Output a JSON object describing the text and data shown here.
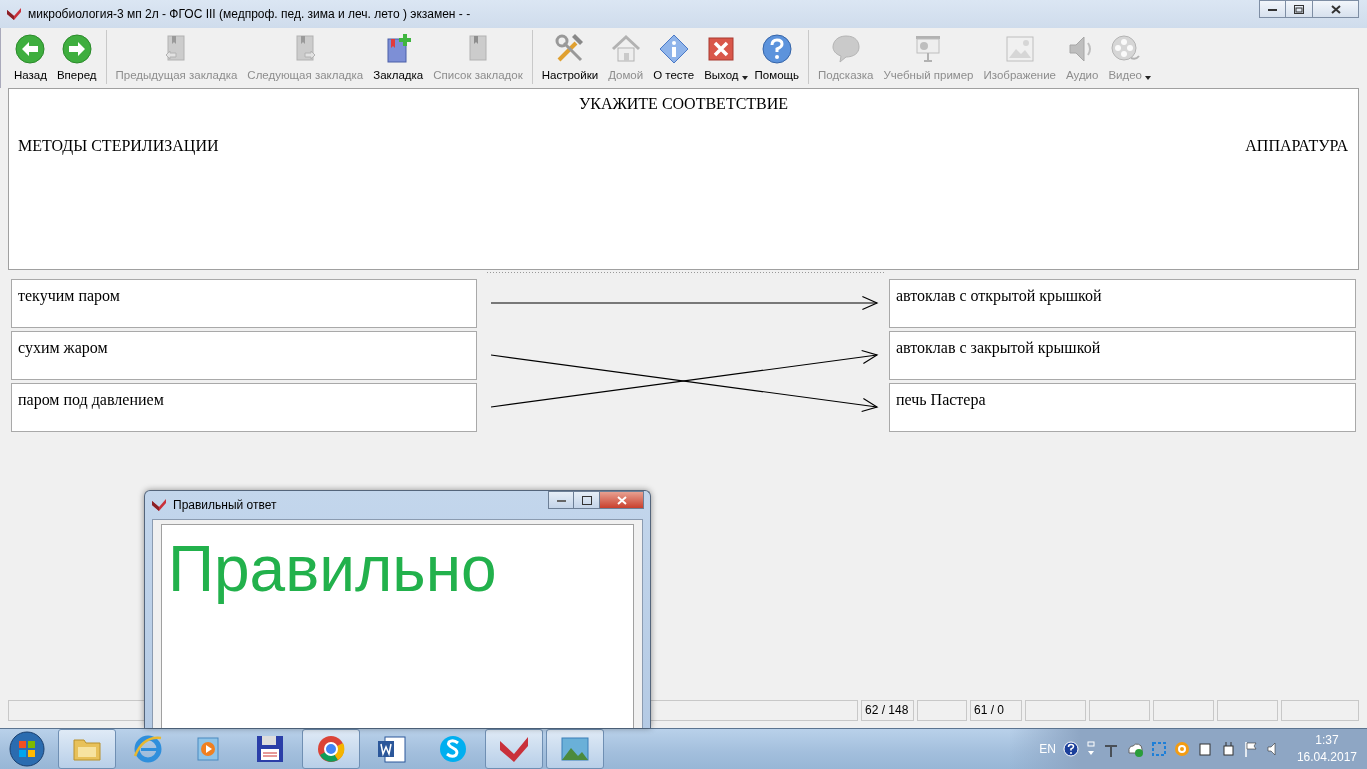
{
  "window": {
    "title": "микробиология-3 мп 2л - ФГОС III (медпроф. пед. зима и леч. лето ) экзамен -  -"
  },
  "toolbar": {
    "groups": [
      {
        "buttons": [
          {
            "label": "Назад",
            "disabled": false,
            "dropdown": false
          },
          {
            "label": "Вперед",
            "disabled": false,
            "dropdown": false
          }
        ]
      },
      {
        "buttons": [
          {
            "label": "Предыдущая закладка",
            "disabled": true,
            "dropdown": false
          },
          {
            "label": "Следующая закладка",
            "disabled": true,
            "dropdown": false
          },
          {
            "label": "Закладка",
            "disabled": false,
            "dropdown": false
          },
          {
            "label": "Список закладок",
            "disabled": true,
            "dropdown": false
          }
        ]
      },
      {
        "buttons": [
          {
            "label": "Настройки",
            "disabled": false,
            "dropdown": false
          },
          {
            "label": "Домой",
            "disabled": true,
            "dropdown": false
          },
          {
            "label": "О тесте",
            "disabled": false,
            "dropdown": false
          },
          {
            "label": "Выход",
            "disabled": false,
            "dropdown": true
          },
          {
            "label": "Помощь",
            "disabled": false,
            "dropdown": false
          }
        ]
      },
      {
        "buttons": [
          {
            "label": "Подсказка",
            "disabled": true,
            "dropdown": false
          },
          {
            "label": "Учебный пример",
            "disabled": true,
            "dropdown": false
          },
          {
            "label": "Изображение",
            "disabled": true,
            "dropdown": false
          },
          {
            "label": "Аудио",
            "disabled": true,
            "dropdown": false
          },
          {
            "label": "Видео",
            "disabled": true,
            "dropdown": true
          }
        ]
      }
    ]
  },
  "question": {
    "instruction": "УКАЖИТЕ СООТВЕТСТВИЕ",
    "left_heading": "МЕТОДЫ СТЕРИЛИЗАЦИИ",
    "right_heading": "АППАРАТУРА"
  },
  "matching": {
    "left_items": [
      {
        "text": "текучим паром",
        "arrow": {
          "kind": "level"
        }
      },
      {
        "text": "сухим жаром",
        "arrow": {
          "kind": "down"
        }
      },
      {
        "text": "паром под давлением",
        "arrow": {
          "kind": "up"
        }
      }
    ],
    "right_items": [
      {
        "text": "автоклав с открытой крышкой"
      },
      {
        "text": "автоклав с закрытой крышкой"
      },
      {
        "text": "печь Пастера"
      }
    ]
  },
  "status_bar": {
    "cells": [
      {
        "kind": "wide"
      },
      {
        "kind": "text",
        "text": "62 / 148"
      },
      {
        "kind": "blank"
      },
      {
        "kind": "text",
        "text": "61 / 0"
      },
      {
        "kind": "blank"
      },
      {
        "kind": "blank"
      },
      {
        "kind": "blank"
      },
      {
        "kind": "blank"
      },
      {
        "kind": "blank"
      }
    ]
  },
  "dialog": {
    "title": "Правильный ответ",
    "result": "Правильно"
  },
  "taskbar": {
    "apps": [
      {
        "selected": true
      },
      {
        "selected": false
      },
      {
        "selected": false
      },
      {
        "selected": false
      },
      {
        "selected": true
      },
      {
        "selected": false
      },
      {
        "selected": false
      },
      {
        "selected": true
      },
      {
        "selected": true
      }
    ],
    "tray": {
      "language": "EN",
      "time": "1:37",
      "date": "16.04.2017"
    }
  }
}
